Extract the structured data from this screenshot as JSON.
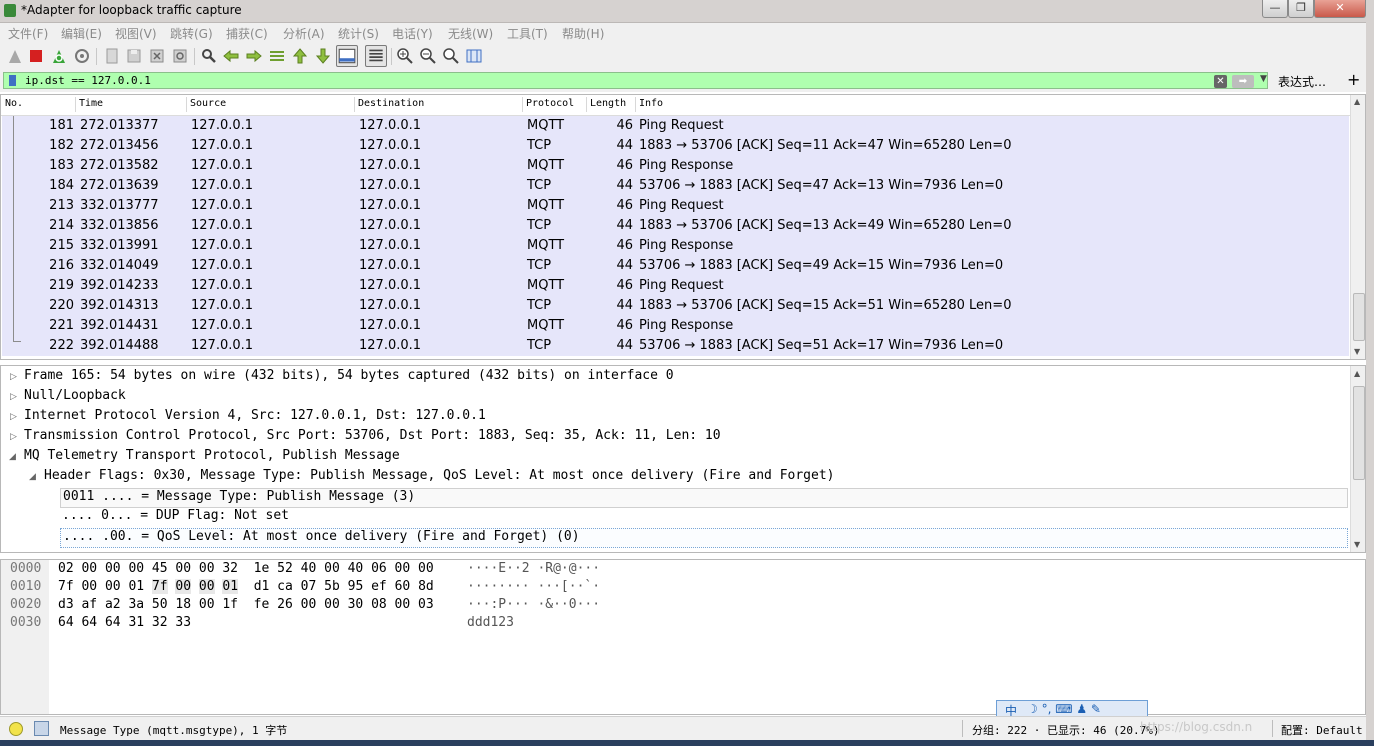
{
  "window": {
    "title": "*Adapter for loopback traffic capture",
    "minimize": "—",
    "maximize": "❐",
    "close": "✕"
  },
  "menu": [
    "文件(F)",
    "编辑(E)",
    "视图(V)",
    "跳转(G)",
    "捕获(C)",
    "分析(A)",
    "统计(S)",
    "电话(Y)",
    "无线(W)",
    "工具(T)",
    "帮助(H)"
  ],
  "toolbar": {
    "icons": [
      "shark-fin-start-icon",
      "stop-capture-icon",
      "restart-capture-icon",
      "capture-options-icon",
      "open-file-icon",
      "save-file-icon",
      "close-file-icon",
      "reload-file-icon",
      "find-packet-icon",
      "go-back-icon",
      "go-forward-icon",
      "go-to-packet-icon",
      "first-packet-icon",
      "last-packet-icon",
      "autoscroll-icon",
      "colorize-icon",
      "zoom-in-icon",
      "zoom-out-icon",
      "normal-size-icon",
      "resize-columns-icon"
    ]
  },
  "filter": {
    "value": "ip.dst == 127.0.0.1",
    "clear": "✕",
    "apply": "➡",
    "dropdown": "▼",
    "expression_button": "表达式…",
    "add_button": "+"
  },
  "packet_list": {
    "columns": [
      "No.",
      "Time",
      "Source",
      "Destination",
      "Protocol",
      "Length",
      "Info"
    ],
    "rows": [
      {
        "no": "181",
        "time": "272.013377",
        "src": "127.0.0.1",
        "dst": "127.0.0.1",
        "proto": "MQTT",
        "len": "46",
        "info": "Ping Request"
      },
      {
        "no": "182",
        "time": "272.013456",
        "src": "127.0.0.1",
        "dst": "127.0.0.1",
        "proto": "TCP",
        "len": "44",
        "info": "1883 → 53706 [ACK] Seq=11 Ack=47 Win=65280 Len=0"
      },
      {
        "no": "183",
        "time": "272.013582",
        "src": "127.0.0.1",
        "dst": "127.0.0.1",
        "proto": "MQTT",
        "len": "46",
        "info": "Ping Response"
      },
      {
        "no": "184",
        "time": "272.013639",
        "src": "127.0.0.1",
        "dst": "127.0.0.1",
        "proto": "TCP",
        "len": "44",
        "info": "53706 → 1883 [ACK] Seq=47 Ack=13 Win=7936 Len=0"
      },
      {
        "no": "213",
        "time": "332.013777",
        "src": "127.0.0.1",
        "dst": "127.0.0.1",
        "proto": "MQTT",
        "len": "46",
        "info": "Ping Request"
      },
      {
        "no": "214",
        "time": "332.013856",
        "src": "127.0.0.1",
        "dst": "127.0.0.1",
        "proto": "TCP",
        "len": "44",
        "info": "1883 → 53706 [ACK] Seq=13 Ack=49 Win=65280 Len=0"
      },
      {
        "no": "215",
        "time": "332.013991",
        "src": "127.0.0.1",
        "dst": "127.0.0.1",
        "proto": "MQTT",
        "len": "46",
        "info": "Ping Response"
      },
      {
        "no": "216",
        "time": "332.014049",
        "src": "127.0.0.1",
        "dst": "127.0.0.1",
        "proto": "TCP",
        "len": "44",
        "info": "53706 → 1883 [ACK] Seq=49 Ack=15 Win=7936 Len=0"
      },
      {
        "no": "219",
        "time": "392.014233",
        "src": "127.0.0.1",
        "dst": "127.0.0.1",
        "proto": "MQTT",
        "len": "46",
        "info": "Ping Request"
      },
      {
        "no": "220",
        "time": "392.014313",
        "src": "127.0.0.1",
        "dst": "127.0.0.1",
        "proto": "TCP",
        "len": "44",
        "info": "1883 → 53706 [ACK] Seq=15 Ack=51 Win=65280 Len=0"
      },
      {
        "no": "221",
        "time": "392.014431",
        "src": "127.0.0.1",
        "dst": "127.0.0.1",
        "proto": "MQTT",
        "len": "46",
        "info": "Ping Response"
      },
      {
        "no": "222",
        "time": "392.014488",
        "src": "127.0.0.1",
        "dst": "127.0.0.1",
        "proto": "TCP",
        "len": "44",
        "info": "53706 → 1883 [ACK] Seq=51 Ack=17 Win=7936 Len=0"
      }
    ],
    "row_color": "#e6e6fa"
  },
  "details": {
    "rows": [
      {
        "text": "Frame 165: 54 bytes on wire (432 bits), 54 bytes captured (432 bits) on interface 0",
        "expander": "▷"
      },
      {
        "text": "Null/Loopback",
        "expander": "▷"
      },
      {
        "text": "Internet Protocol Version 4, Src: 127.0.0.1, Dst: 127.0.0.1",
        "expander": "▷"
      },
      {
        "text": "Transmission Control Protocol, Src Port: 53706, Dst Port: 1883, Seq: 35, Ack: 11, Len: 10",
        "expander": "▷"
      },
      {
        "text": "MQ Telemetry Transport Protocol, Publish Message",
        "expander": "◢"
      },
      {
        "text": "Header Flags: 0x30, Message Type: Publish Message, QoS Level: At most once delivery (Fire and Forget)",
        "expander": "◢"
      },
      {
        "text": "0011 .... = Message Type: Publish Message (3)",
        "expander": ""
      },
      {
        "text": ".... 0... = DUP Flag: Not set",
        "expander": ""
      },
      {
        "text": ".... .00. = QoS Level: At most once delivery (Fire and Forget) (0)",
        "expander": ""
      }
    ]
  },
  "bytes": {
    "rows": [
      {
        "offset": "0000",
        "hex_a": "02 00 00 00 45 00 00 32",
        "hex_b": "1e 52 40 00 40 06 00 00",
        "ascii": "····E··2 ·R@·@···"
      },
      {
        "offset": "0010",
        "hex_a": "7f 00 00 01 7f 00 00 01",
        "hex_b": "d1 ca 07 5b 95 ef 60 8d",
        "ascii": "········ ···[··`·"
      },
      {
        "offset": "0020",
        "hex_a": "d3 af a2 3a 50 18 00 1f",
        "hex_b": "fe 26 00 00 30 08 00 03",
        "ascii": "···:P··· ·&··0···"
      },
      {
        "offset": "0030",
        "hex_a": "64 64 64 31 32 33",
        "hex_b": "",
        "ascii": "ddd123"
      }
    ]
  },
  "ime": {
    "label": "中",
    "glyphs": "☽ °, ⌨ ♟ ✎"
  },
  "status": {
    "message": "Message Type (mqtt.msgtype), 1 字节",
    "packets": "分组: 222 · 已显示: 46 (20.7%)",
    "profile": "配置: Default",
    "watermark": "https://blog.csdn.n"
  }
}
